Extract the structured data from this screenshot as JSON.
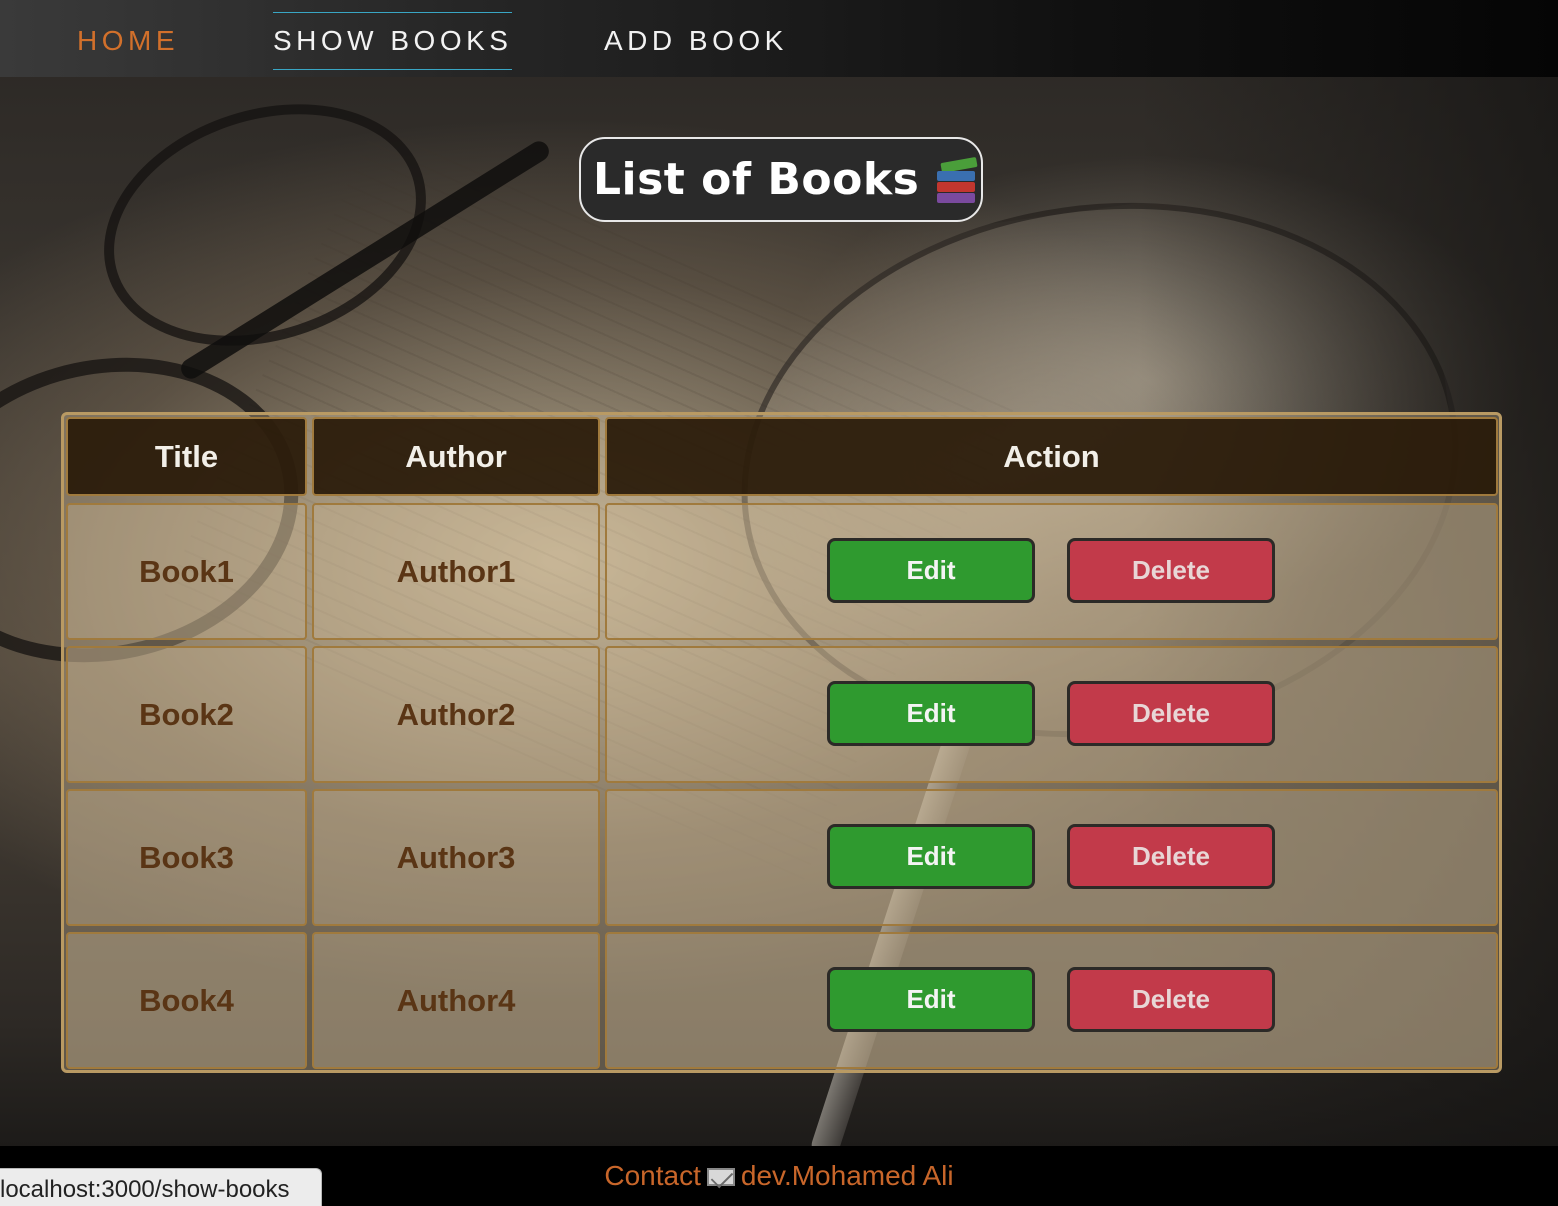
{
  "nav": {
    "home": "HOME",
    "show_books": "SHOW BOOKS",
    "add_book": "ADD BOOK",
    "active": "SHOW BOOKS",
    "home_color": "#d2702b",
    "active_underline_color": "#39a6c4"
  },
  "page": {
    "title": "List of Books",
    "title_icon": "books-icon"
  },
  "table": {
    "headers": [
      "Title",
      "Author",
      "Action"
    ],
    "rows": [
      {
        "title": "Book1",
        "author": "Author1"
      },
      {
        "title": "Book2",
        "author": "Author2"
      },
      {
        "title": "Book3",
        "author": "Author3"
      },
      {
        "title": "Book4",
        "author": "Author4"
      }
    ],
    "edit_label": "Edit",
    "delete_label": "Delete",
    "edit_color": "#2f9a2f",
    "delete_color": "#c23a4a"
  },
  "footer": {
    "contact_label": "Contact",
    "contact_icon": "mail-icon",
    "author": "dev.Mohamed Ali",
    "text_color": "#c8662a"
  },
  "status_bar": {
    "url": "localhost:3000/show-books"
  }
}
